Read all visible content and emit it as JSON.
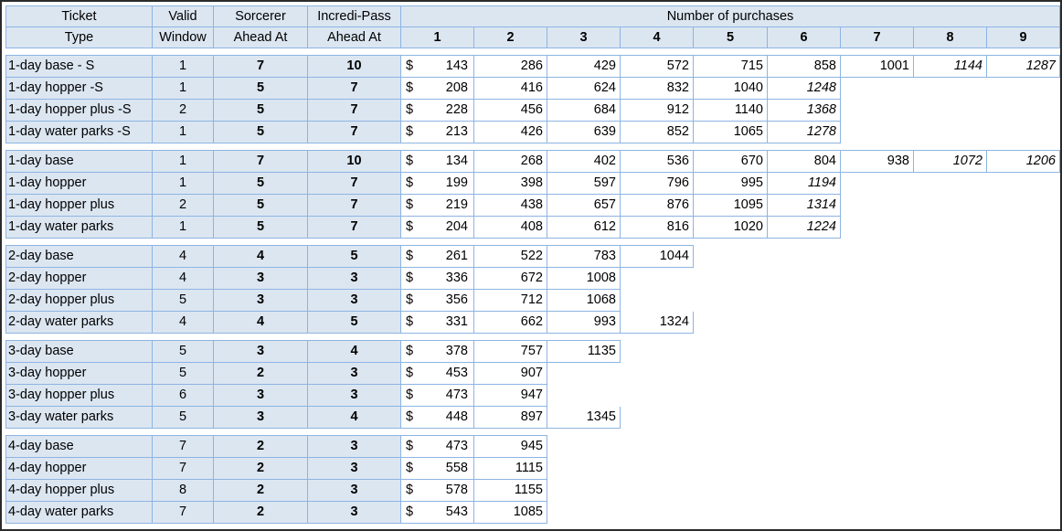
{
  "header": {
    "ticket_type": [
      "Ticket",
      "Type"
    ],
    "valid_window": [
      "Valid",
      "Window"
    ],
    "sorcerer": [
      "Sorcerer",
      "Ahead At"
    ],
    "incredi": [
      "Incredi-Pass",
      "Ahead At"
    ],
    "purchases_title": "Number of purchases",
    "purchase_numbers": [
      "1",
      "2",
      "3",
      "4",
      "5",
      "6",
      "7",
      "8",
      "9"
    ]
  },
  "currency_symbol": "$",
  "groups": [
    {
      "rows": [
        {
          "type": "1-day base - S",
          "window": "1",
          "sorcerer": "7",
          "incredi": "10",
          "prices": [
            "143",
            "286",
            "429",
            "572",
            "715",
            "858",
            "1001",
            "1144",
            "1287"
          ],
          "italic_from": 7
        },
        {
          "type": "1-day hopper -S",
          "window": "1",
          "sorcerer": "5",
          "incredi": "7",
          "prices": [
            "208",
            "416",
            "624",
            "832",
            "1040",
            "1248"
          ],
          "italic_from": 5
        },
        {
          "type": "1-day hopper plus -S",
          "window": "2",
          "sorcerer": "5",
          "incredi": "7",
          "prices": [
            "228",
            "456",
            "684",
            "912",
            "1140",
            "1368"
          ],
          "italic_from": 5
        },
        {
          "type": "1-day water parks -S",
          "window": "1",
          "sorcerer": "5",
          "incredi": "7",
          "prices": [
            "213",
            "426",
            "639",
            "852",
            "1065",
            "1278"
          ],
          "italic_from": 5
        }
      ]
    },
    {
      "rows": [
        {
          "type": "1-day base",
          "window": "1",
          "sorcerer": "7",
          "incredi": "10",
          "prices": [
            "134",
            "268",
            "402",
            "536",
            "670",
            "804",
            "938",
            "1072",
            "1206"
          ],
          "italic_from": 7
        },
        {
          "type": "1-day hopper",
          "window": "1",
          "sorcerer": "5",
          "incredi": "7",
          "prices": [
            "199",
            "398",
            "597",
            "796",
            "995",
            "1194"
          ],
          "italic_from": 5
        },
        {
          "type": "1-day hopper plus",
          "window": "2",
          "sorcerer": "5",
          "incredi": "7",
          "prices": [
            "219",
            "438",
            "657",
            "876",
            "1095",
            "1314"
          ],
          "italic_from": 5
        },
        {
          "type": "1-day water parks",
          "window": "1",
          "sorcerer": "5",
          "incredi": "7",
          "prices": [
            "204",
            "408",
            "612",
            "816",
            "1020",
            "1224"
          ],
          "italic_from": 5
        }
      ]
    },
    {
      "rows": [
        {
          "type": "2-day base",
          "window": "4",
          "sorcerer": "4",
          "incredi": "5",
          "prices": [
            "261",
            "522",
            "783",
            "1044"
          ],
          "italic_from": 4
        },
        {
          "type": "2-day hopper",
          "window": "4",
          "sorcerer": "3",
          "incredi": "3",
          "prices": [
            "336",
            "672",
            "1008"
          ],
          "italic_from": 3
        },
        {
          "type": "2-day hopper plus",
          "window": "5",
          "sorcerer": "3",
          "incredi": "3",
          "prices": [
            "356",
            "712",
            "1068"
          ],
          "italic_from": 3
        },
        {
          "type": "2-day water parks",
          "window": "4",
          "sorcerer": "4",
          "incredi": "5",
          "prices": [
            "331",
            "662",
            "993",
            "1324"
          ],
          "italic_from": 4
        }
      ]
    },
    {
      "rows": [
        {
          "type": "3-day base",
          "window": "5",
          "sorcerer": "3",
          "incredi": "4",
          "prices": [
            "378",
            "757",
            "1135"
          ],
          "italic_from": 3
        },
        {
          "type": "3-day hopper",
          "window": "5",
          "sorcerer": "2",
          "incredi": "3",
          "prices": [
            "453",
            "907"
          ],
          "italic_from": 2
        },
        {
          "type": "3-day hopper plus",
          "window": "6",
          "sorcerer": "3",
          "incredi": "3",
          "prices": [
            "473",
            "947"
          ],
          "italic_from": 3
        },
        {
          "type": "3-day water parks",
          "window": "5",
          "sorcerer": "3",
          "incredi": "4",
          "prices": [
            "448",
            "897",
            "1345"
          ],
          "italic_from": 3
        }
      ]
    },
    {
      "rows": [
        {
          "type": "4-day base",
          "window": "7",
          "sorcerer": "2",
          "incredi": "3",
          "prices": [
            "473",
            "945"
          ],
          "italic_from": 2
        },
        {
          "type": "4-day hopper",
          "window": "7",
          "sorcerer": "2",
          "incredi": "3",
          "prices": [
            "558",
            "1115"
          ],
          "italic_from": 2
        },
        {
          "type": "4-day hopper plus",
          "window": "8",
          "sorcerer": "2",
          "incredi": "3",
          "prices": [
            "578",
            "1155"
          ],
          "italic_from": 2
        },
        {
          "type": "4-day water parks",
          "window": "7",
          "sorcerer": "2",
          "incredi": "3",
          "prices": [
            "543",
            "1085"
          ],
          "italic_from": 2
        }
      ]
    }
  ]
}
